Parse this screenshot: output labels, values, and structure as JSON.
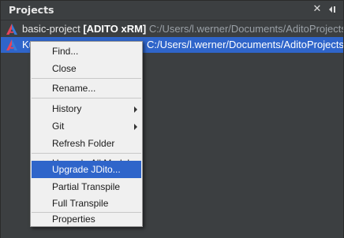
{
  "panel": {
    "title": "Projects",
    "close_icon": "close-x-icon",
    "minimize_icon": "minimize-panel-icon"
  },
  "projects": [
    {
      "icon": "adito-logo-icon",
      "name": "basic-project",
      "tag": "[ADITO xRM]",
      "path": "C:/Users/l.werner/Documents/AditoProjects/ba"
    },
    {
      "icon": "adito-logo-icon",
      "name": "Kun",
      "tag": "",
      "path": "C:/Users/l.werner/Documents/AditoProjects/k"
    }
  ],
  "context_menu": {
    "items": [
      {
        "label": "Find..."
      },
      {
        "label": "Close"
      },
      {
        "label": "Rename..."
      },
      {
        "label": "History",
        "submenu": true
      },
      {
        "label": "Git",
        "submenu": true
      },
      {
        "label": "Refresh Folder"
      },
      {
        "label": "Upgrade All Models"
      },
      {
        "label": "Upgrade JDito...",
        "highlighted": true
      },
      {
        "label": "Partial Transpile"
      },
      {
        "label": "Full Transpile"
      },
      {
        "label": "Properties"
      }
    ]
  },
  "colors": {
    "panel_bg": "#3c3f41",
    "selection": "#2f65ca",
    "menu_bg": "#f0f0f0",
    "logo_red": "#e8445a",
    "logo_blue": "#3a7bd5"
  }
}
